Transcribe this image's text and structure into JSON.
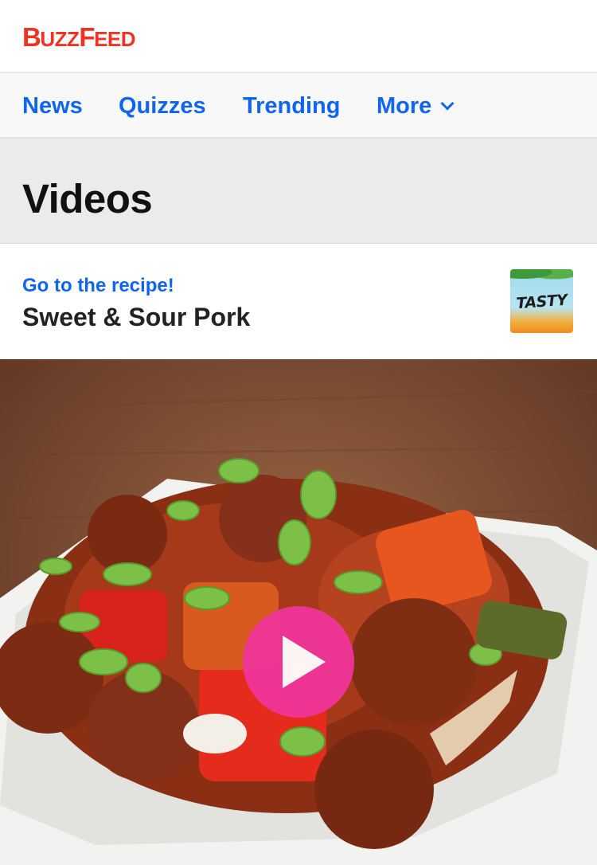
{
  "header": {
    "logo_text": "BuzzFeed"
  },
  "nav": {
    "items": [
      {
        "label": "News"
      },
      {
        "label": "Quizzes"
      },
      {
        "label": "Trending"
      },
      {
        "label": "More"
      }
    ]
  },
  "section": {
    "title": "Videos"
  },
  "recipe": {
    "link_label": "Go to the recipe!",
    "title": "Sweet & Sour Pork",
    "badge_text": "TASTY"
  },
  "video": {
    "thumbnail": "sweet-and-sour-pork-bowl",
    "play_icon": "play-icon",
    "accent_color": "#f0359a"
  },
  "colors": {
    "brand": "#ee3322",
    "link": "#0f65ef"
  }
}
